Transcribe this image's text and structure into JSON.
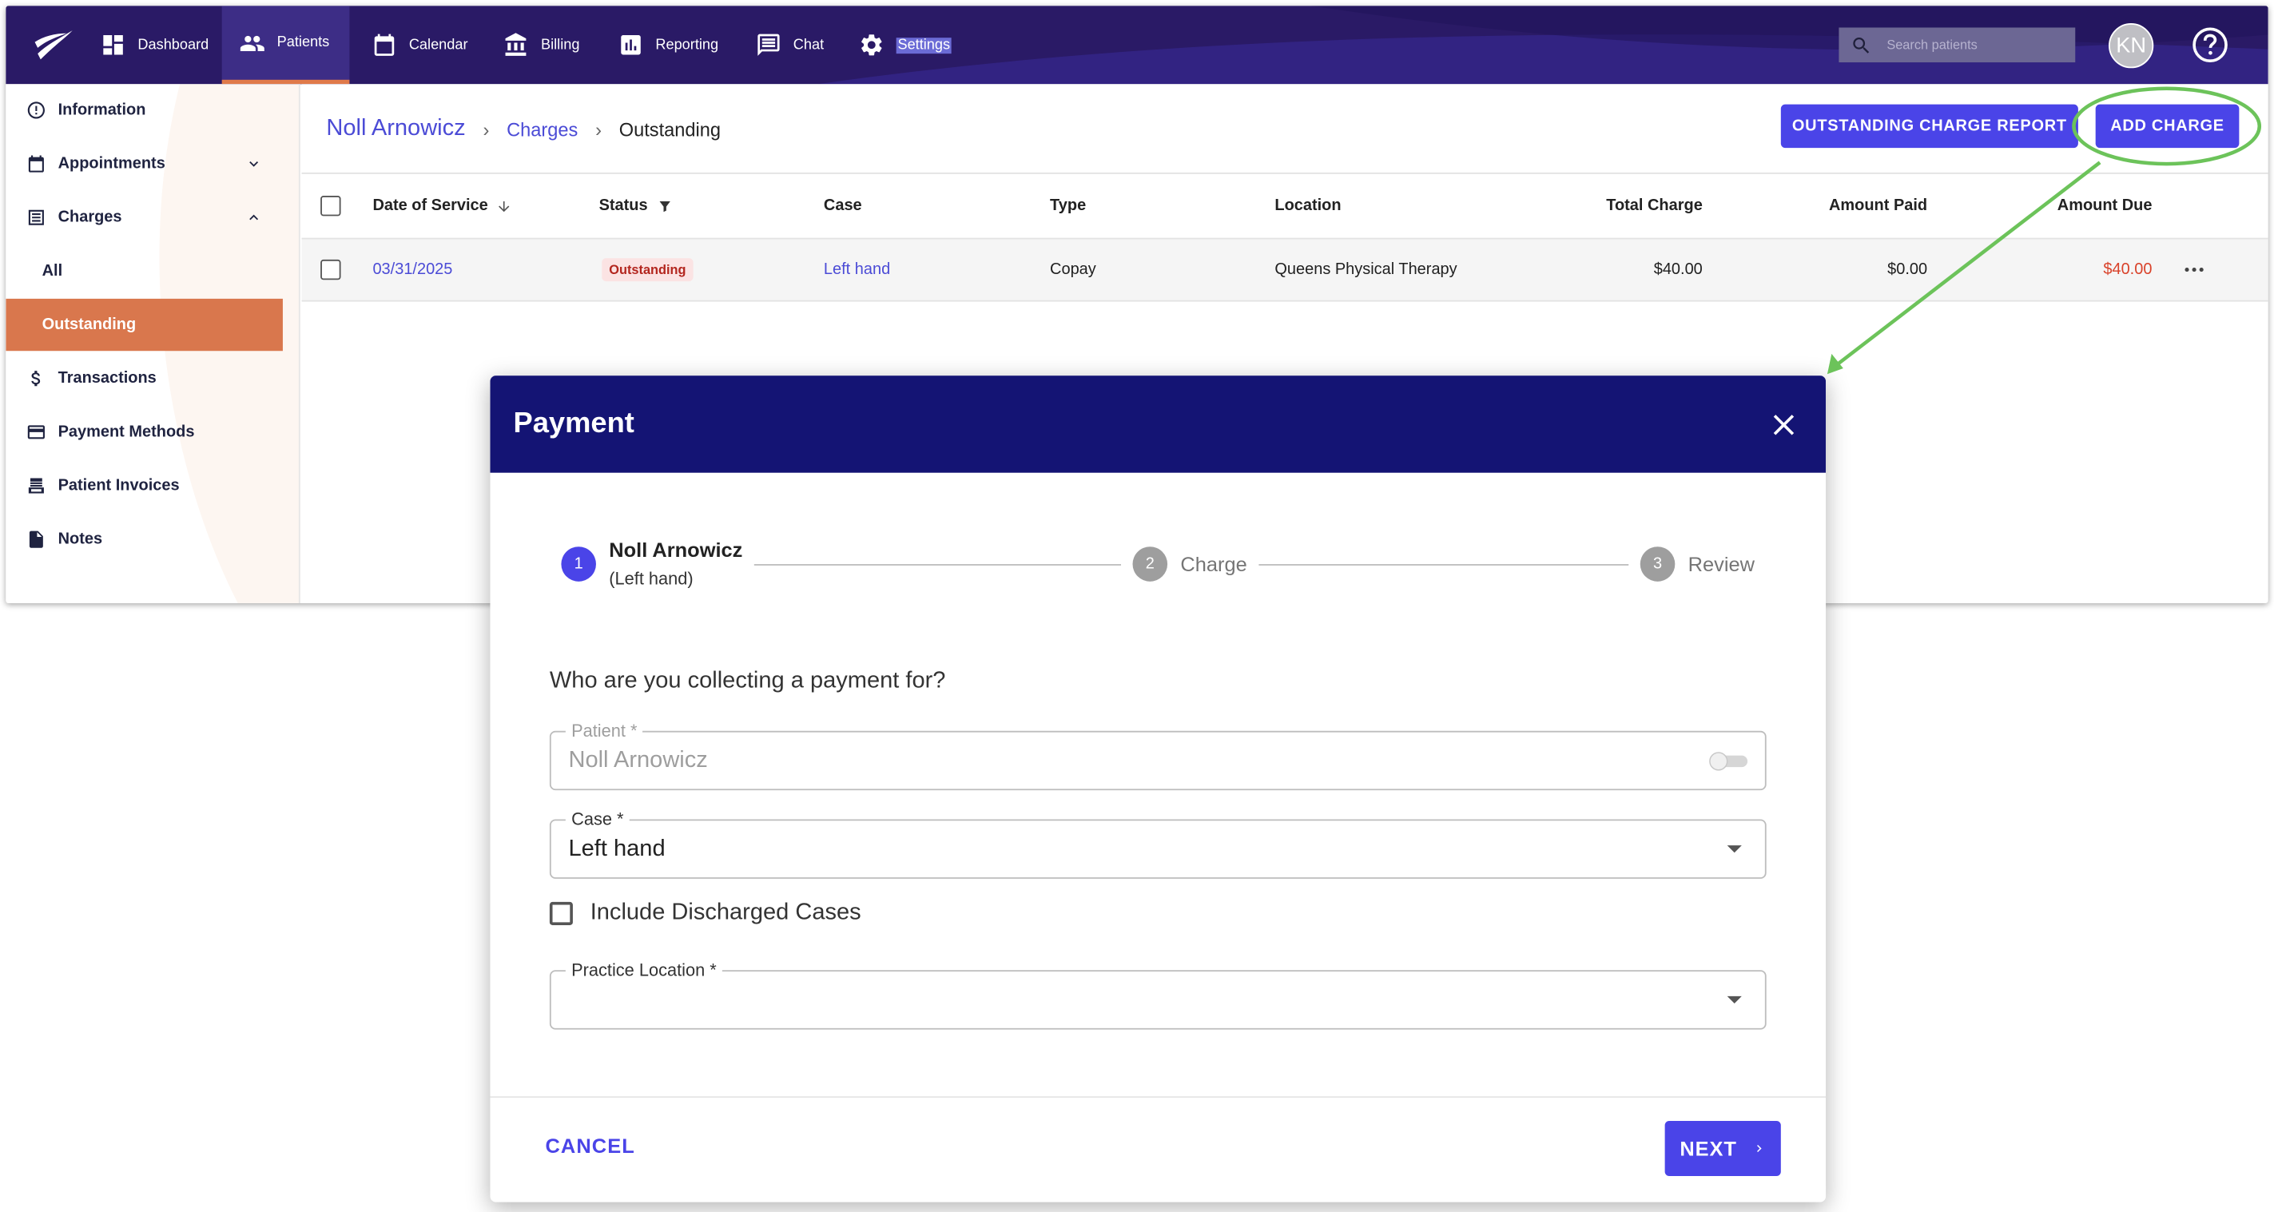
{
  "topnav": {
    "items": [
      {
        "label": "Dashboard",
        "icon": "dashboard-icon"
      },
      {
        "label": "Patients",
        "icon": "patients-icon"
      },
      {
        "label": "Calendar",
        "icon": "calendar-icon"
      },
      {
        "label": "Billing",
        "icon": "billing-icon"
      },
      {
        "label": "Reporting",
        "icon": "reporting-icon"
      },
      {
        "label": "Chat",
        "icon": "chat-icon"
      },
      {
        "label": "Settings",
        "icon": "gear-icon"
      }
    ],
    "active": "Patients",
    "search_placeholder": "Search patients",
    "avatar_initials": "KN"
  },
  "sidebar": {
    "items": [
      {
        "label": "Information",
        "icon": "info-icon"
      },
      {
        "label": "Appointments",
        "icon": "calendar-icon"
      },
      {
        "label": "Charges",
        "icon": "list-icon"
      },
      {
        "label": "All"
      },
      {
        "label": "Outstanding"
      },
      {
        "label": "Transactions",
        "icon": "dollar-icon"
      },
      {
        "label": "Payment Methods",
        "icon": "credit-card-icon"
      },
      {
        "label": "Patient Invoices",
        "icon": "invoice-icon"
      },
      {
        "label": "Notes",
        "icon": "note-icon"
      }
    ],
    "active": "Outstanding"
  },
  "breadcrumb": {
    "patient": "Noll Arnowicz",
    "section": "Charges",
    "current": "Outstanding"
  },
  "actions": {
    "report": "OUTSTANDING CHARGE REPORT",
    "add": "ADD CHARGE"
  },
  "table": {
    "headers": [
      "Date of Service",
      "Status",
      "Case",
      "Type",
      "Location",
      "Total Charge",
      "Amount Paid",
      "Amount Due"
    ],
    "rows": [
      {
        "date": "03/31/2025",
        "status": "Outstanding",
        "case": "Left hand",
        "type": "Copay",
        "location": "Queens Physical Therapy",
        "total": "$40.00",
        "paid": "$0.00",
        "due": "$40.00"
      }
    ]
  },
  "modal": {
    "title": "Payment",
    "steps": [
      {
        "number": "1",
        "label": "Noll Arnowicz",
        "sublabel": "(Left hand)"
      },
      {
        "number": "2",
        "label": "Charge"
      },
      {
        "number": "3",
        "label": "Review"
      }
    ],
    "question": "Who are you collecting a payment for?",
    "patient_field": {
      "label": "Patient *",
      "value": "Noll Arnowicz"
    },
    "case_field": {
      "label": "Case *",
      "value": "Left hand"
    },
    "discharged_checkbox": {
      "label": "Include Discharged Cases",
      "checked": false
    },
    "location_field": {
      "label": "Practice Location *",
      "value": ""
    },
    "cancel": "CANCEL",
    "next": "NEXT"
  },
  "colors": {
    "nav_bg": "#2a1a66",
    "accent": "#4a44e8",
    "active_sidebar": "#d9774d",
    "modal_header": "#141474",
    "annotation": "#6cc35a",
    "due": "#d9422a"
  }
}
